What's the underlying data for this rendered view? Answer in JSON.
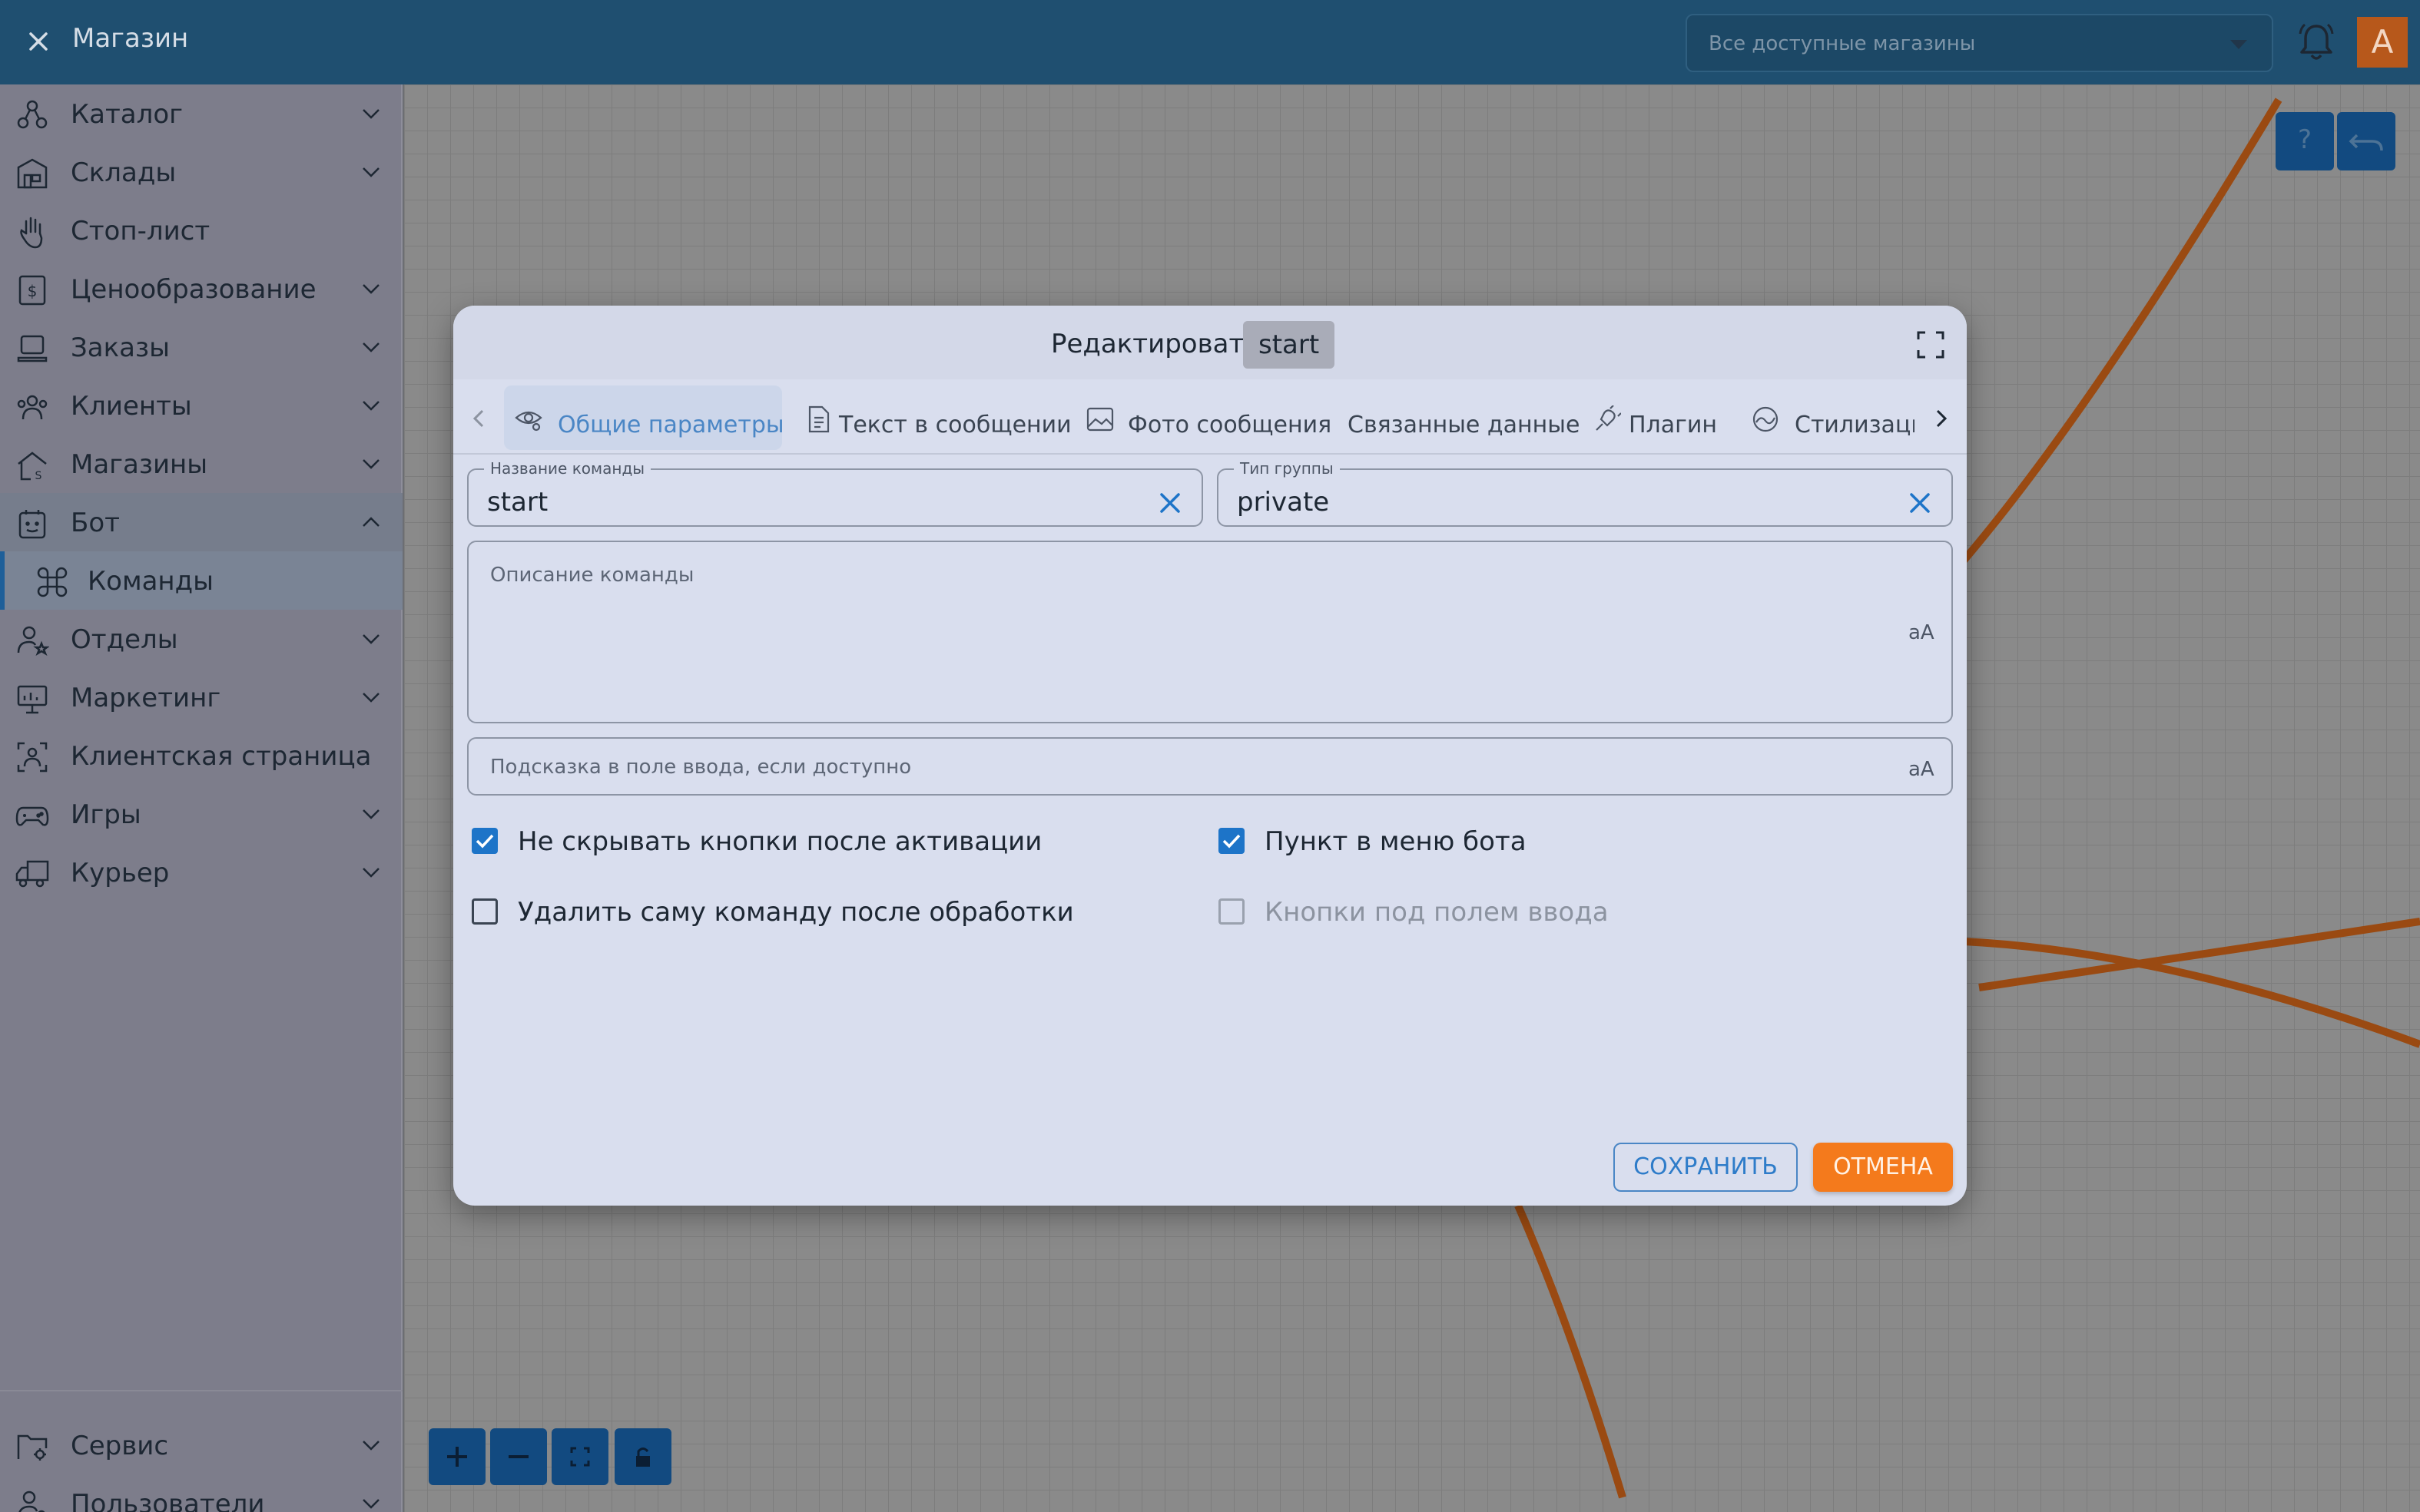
{
  "topbar": {
    "title": "Магазин",
    "store_select_placeholder": "Все доступные магазины",
    "avatar_initial": "A"
  },
  "sidebar": {
    "items": [
      {
        "label": "Каталог",
        "icon": "catalog-icon"
      },
      {
        "label": "Склады",
        "icon": "warehouse-icon"
      },
      {
        "label": "Стоп-лист",
        "icon": "hand-stop-icon"
      },
      {
        "label": "Ценообразование",
        "icon": "price-tag-icon"
      },
      {
        "label": "Заказы",
        "icon": "orders-icon"
      },
      {
        "label": "Клиенты",
        "icon": "clients-icon"
      },
      {
        "label": "Магазины",
        "icon": "stores-icon"
      },
      {
        "label": "Бот",
        "icon": "bot-icon"
      },
      {
        "label": "Команды",
        "icon": "command-icon"
      },
      {
        "label": "Отделы",
        "icon": "departments-icon"
      },
      {
        "label": "Маркетинг",
        "icon": "marketing-icon"
      },
      {
        "label": "Клиентская страница",
        "icon": "client-page-icon"
      },
      {
        "label": "Игры",
        "icon": "gamepad-icon"
      },
      {
        "label": "Курьер",
        "icon": "courier-icon"
      }
    ],
    "bottom_items": [
      {
        "label": "Сервис",
        "icon": "service-icon"
      },
      {
        "label": "Пользователи",
        "icon": "users-icon"
      }
    ]
  },
  "canvas": {
    "help_label": "?"
  },
  "modal": {
    "title": "Редактировать",
    "chip": "start",
    "tabs": [
      {
        "label": "Общие параметры",
        "icon": "eye-settings-icon",
        "active": true
      },
      {
        "label": "Текст в сообщении",
        "icon": "document-icon"
      },
      {
        "label": "Фото сообщения",
        "icon": "image-icon"
      },
      {
        "label": "Связанные данные"
      },
      {
        "label": "Плагин",
        "icon": "plug-icon"
      },
      {
        "label": "Стилизаци",
        "icon": "style-icon"
      }
    ],
    "fields": {
      "command_name": {
        "label": "Название команды",
        "value": "start"
      },
      "group_type": {
        "label": "Тип группы",
        "value": "private"
      },
      "description": {
        "placeholder": "Описание команды"
      },
      "input_hint": {
        "placeholder": "Подсказка в поле ввода, если доступно"
      }
    },
    "checkboxes": [
      {
        "label": "Не скрывать кнопки после активации",
        "checked": true
      },
      {
        "label": "Пункт в меню бота",
        "checked": true
      },
      {
        "label": "Удалить саму команду после обработки",
        "checked": false
      },
      {
        "label": "Кнопки под полем ввода",
        "checked": false,
        "disabled": true
      }
    ],
    "save_label": "СОХРАНИТЬ",
    "cancel_label": "ОТМЕНА"
  },
  "colors": {
    "topbar": "#1f4f70",
    "accent_blue": "#1d74c8",
    "accent_orange": "#f47a1c",
    "edge_orange": "#9a4a12"
  }
}
